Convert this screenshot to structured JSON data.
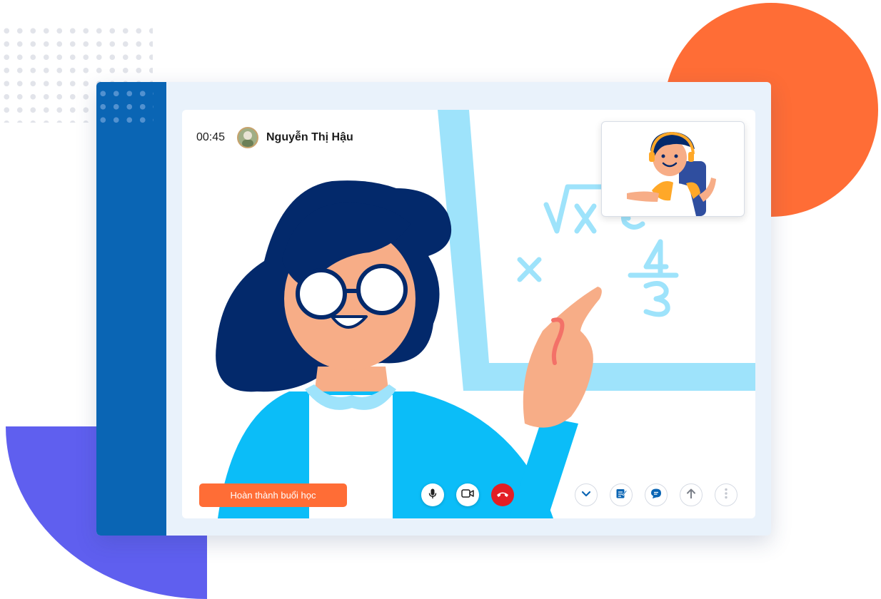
{
  "call": {
    "timer": "00:45",
    "teacher_name": "Nguyễn Thị Hậu"
  },
  "actions": {
    "finish_lesson_label": "Hoàn thành buổi học"
  },
  "controls": {
    "left_icons": [
      "microphone-icon",
      "camera-icon",
      "end-call-icon"
    ],
    "right_icons": [
      "chevron-down-icon",
      "notes-icon",
      "chat-icon",
      "upload-arrow-icon",
      "more-vertical-icon"
    ]
  },
  "colors": {
    "brand_blue": "#0a65b4",
    "accent_orange": "#ff6d36",
    "end_call_red": "#e31e24",
    "decor_purple": "#5f5fef",
    "frame_bg": "#e9f2fb"
  }
}
